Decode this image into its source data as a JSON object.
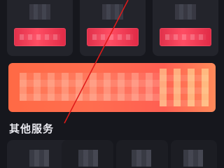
{
  "colors": {
    "background": "#16171d",
    "card": "#23242b",
    "action_red": "#ff4d63",
    "banner_orange": "#ff6a45",
    "annotation_line": "#e01a1a"
  },
  "top_cards": [
    {
      "icon": "pixelated-icon",
      "action": "pixelated-red-button"
    },
    {
      "icon": "pixelated-icon",
      "action": "pixelated-red-button"
    },
    {
      "icon": "pixelated-icon",
      "action": "pixelated-red-button"
    }
  ],
  "banner": {
    "icon": "pixelated-promo-banner"
  },
  "section": {
    "title": "其他服务"
  },
  "bottom_tiles": [
    {
      "icon": "pixelated-icon"
    },
    {
      "icon": "pixelated-icon"
    },
    {
      "icon": "pixelated-icon"
    },
    {
      "icon": "pixelated-icon"
    }
  ]
}
